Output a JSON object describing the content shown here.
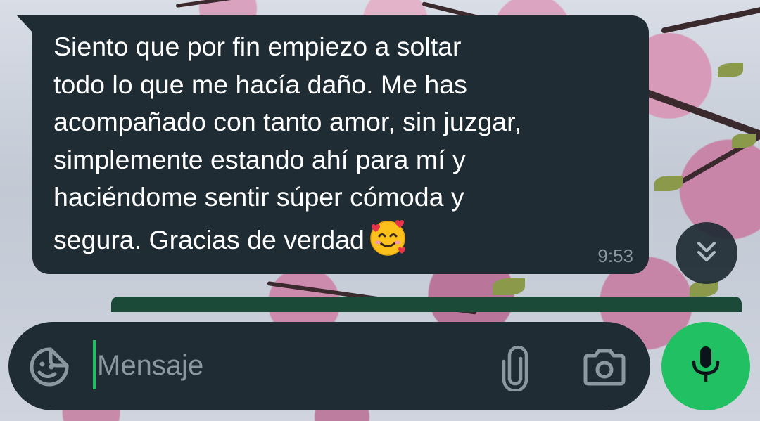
{
  "chat": {
    "message": {
      "text": "Siento que por fin empiezo a soltar\ntodo lo que me hacía daño. Me has\nacompañado con tanto amor, sin juzgar,\nsimplemente estando ahí para mí y\nhaciéndome sentir súper cómoda y\nsegura. Gracias de verdad",
      "emoji": "smiling-face-with-hearts",
      "time": "9:53",
      "direction": "incoming"
    }
  },
  "composer": {
    "placeholder": "Mensaje",
    "value": ""
  },
  "icons": {
    "emoji_button": "sticker-smiley-icon",
    "attach_button": "paperclip-icon",
    "camera_button": "camera-icon",
    "mic_button": "microphone-icon",
    "scroll_button": "double-chevron-down-icon"
  },
  "colors": {
    "bubble": "#1f2c34",
    "input_bar": "#1f2c34",
    "accent_green": "#21c063",
    "text_primary": "#ffffff",
    "text_secondary": "#8b989f"
  }
}
